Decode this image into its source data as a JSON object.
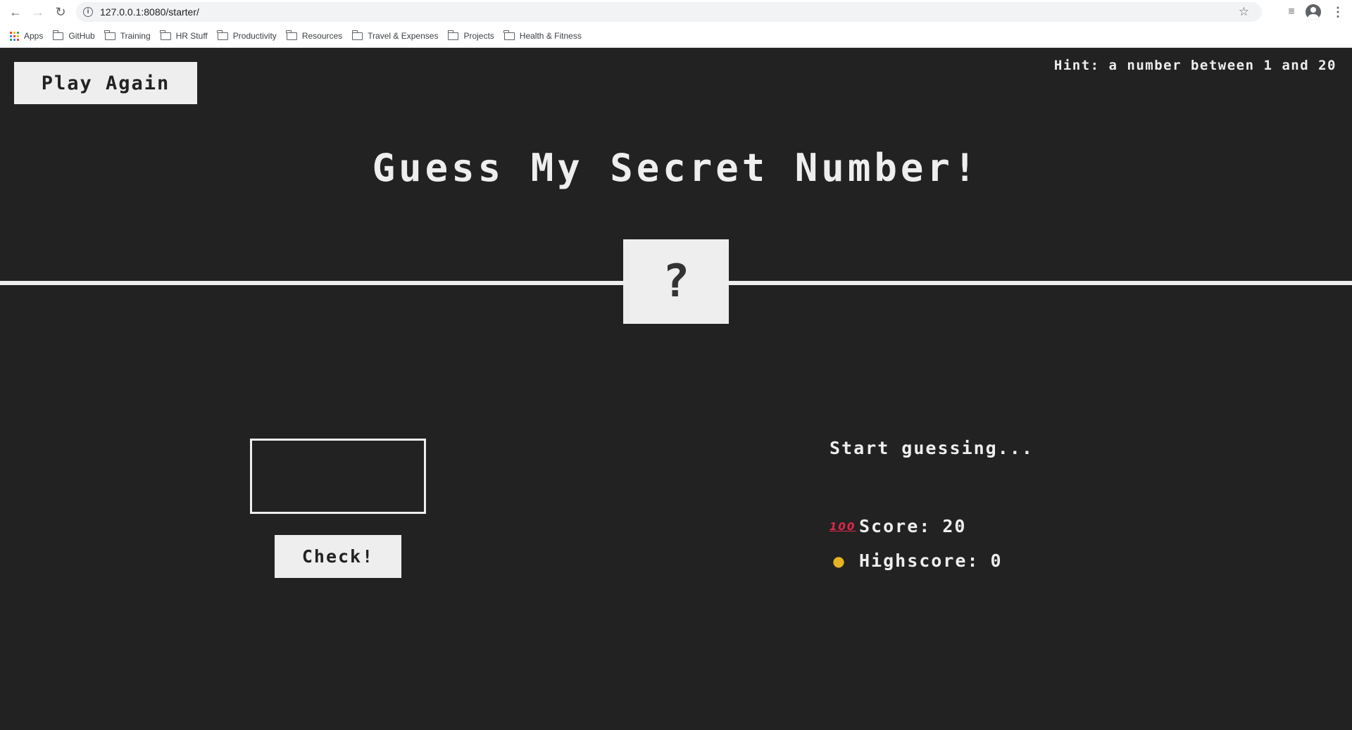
{
  "browser": {
    "url": "127.0.0.1:8080/starter/",
    "bookmarks": [
      "Apps",
      "GitHub",
      "Training",
      "HR Stuff",
      "Productivity",
      "Resources",
      "Travel & Expenses",
      "Projects",
      "Health & Fitness"
    ]
  },
  "game": {
    "again_label": "Play Again",
    "hint": "Hint: a number between 1 and 20",
    "title": "Guess My Secret Number!",
    "secret": "?",
    "guess_value": "",
    "check_label": "Check!",
    "message": "Start guessing...",
    "score_label": "Score:",
    "score": "20",
    "highscore_label": "Highscore:",
    "highscore": "0"
  },
  "colors": {
    "background": "#222222",
    "foreground": "#eeeeee"
  }
}
